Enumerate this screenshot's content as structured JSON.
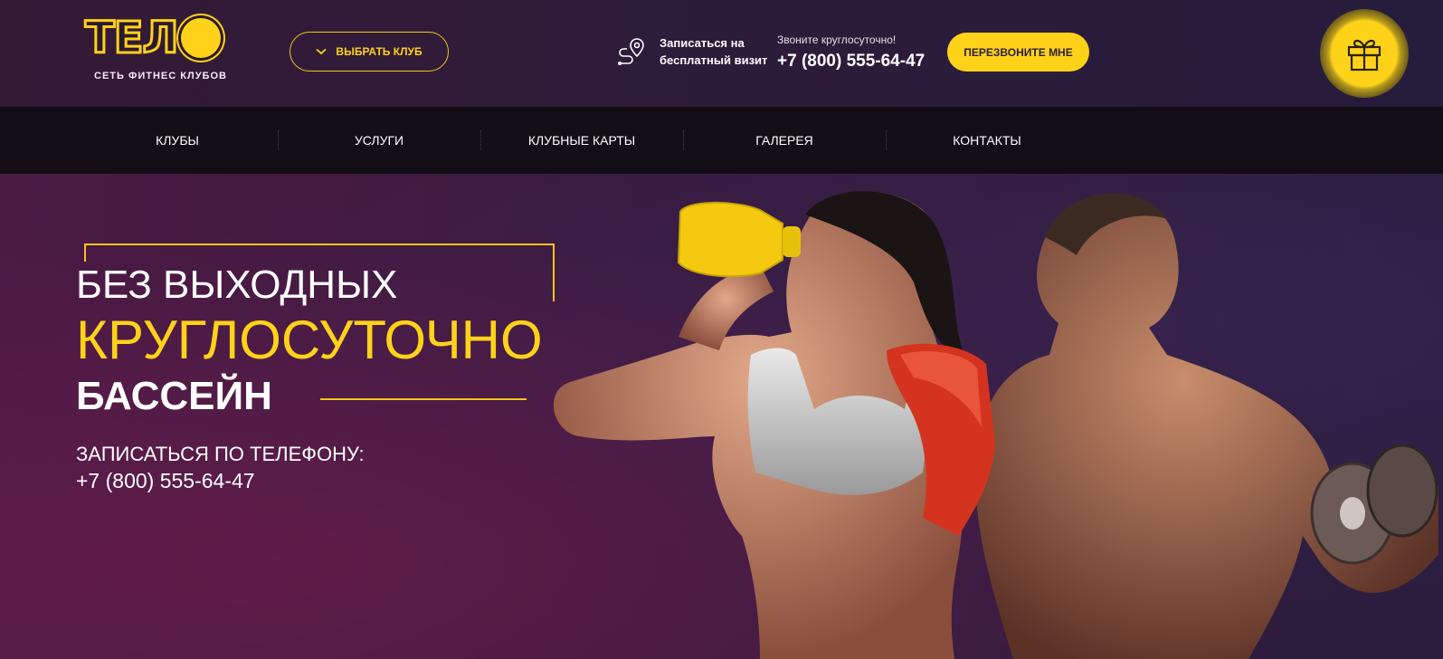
{
  "colors": {
    "accent": "#ffd21a",
    "header_bg": "#2d1c3a",
    "nav_bg": "#130d15",
    "hero_bg": "#3a1a3f"
  },
  "logo": {
    "letters": [
      "Т",
      "Е",
      "Л"
    ],
    "subtitle": "СЕТЬ ФИТНЕС КЛУБОВ"
  },
  "header": {
    "club_button_label": "ВЫБРАТЬ КЛУБ",
    "club_button_icon": "chevron-down-icon",
    "visit_icon": "map-route-icon",
    "visit_text": "Записаться на бесплатный визит",
    "phone_caption": "Звоните круглосуточно!",
    "phone_number": "+7 (800) 555-64-47",
    "callback_label": "ПЕРЕЗВОНИТЕ МНЕ",
    "gift_icon": "gift-icon"
  },
  "nav": {
    "items": [
      {
        "label": "КЛУБЫ"
      },
      {
        "label": "УСЛУГИ"
      },
      {
        "label": "КЛУБНЫЕ КАРТЫ"
      },
      {
        "label": "ГАЛЕРЕЯ"
      },
      {
        "label": "КОНТАКТЫ"
      }
    ]
  },
  "hero": {
    "line1": "БЕЗ ВЫХОДНЫХ",
    "line2": "КРУГЛОСУТОЧНО",
    "line3": "БАССЕЙН",
    "cta_label": "ЗАПИСАТЬСЯ ПО ТЕЛЕФОНУ:",
    "cta_phone": "+7 (800) 555-64-47"
  }
}
